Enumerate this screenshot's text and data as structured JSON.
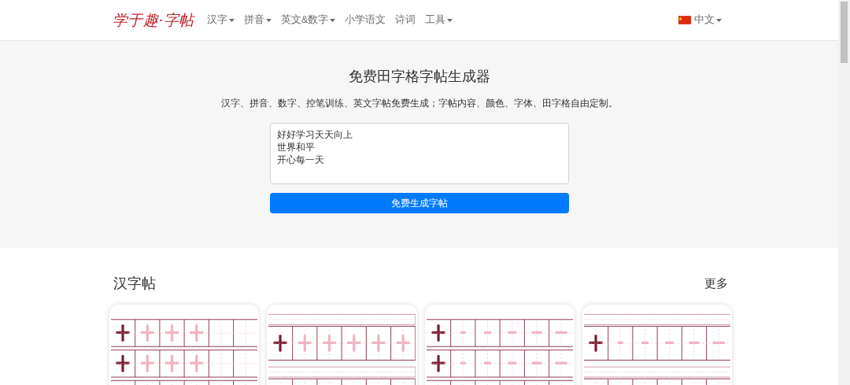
{
  "navbar": {
    "logo": "学于趣·字帖",
    "menu": [
      {
        "label": "汉字",
        "dropdown": true
      },
      {
        "label": "拼音",
        "dropdown": true
      },
      {
        "label": "英文&数字",
        "dropdown": true
      },
      {
        "label": "小学语文",
        "dropdown": false
      },
      {
        "label": "诗词",
        "dropdown": false
      },
      {
        "label": "工具",
        "dropdown": true
      }
    ],
    "language": {
      "label": "中文",
      "dropdown": true
    }
  },
  "hero": {
    "title": "免费田字格字帖生成器",
    "subtitle": "汉字、拼音、数字、控笔训练、英文字帖免费生成；字帖内容、颜色、字体、田字格自由定制。",
    "textarea_lines": [
      "好好学习天天向上",
      "世界和平",
      "开心每一天"
    ],
    "button": "免费生成字帖"
  },
  "section": {
    "title": "汉字帖",
    "more": "更多"
  }
}
